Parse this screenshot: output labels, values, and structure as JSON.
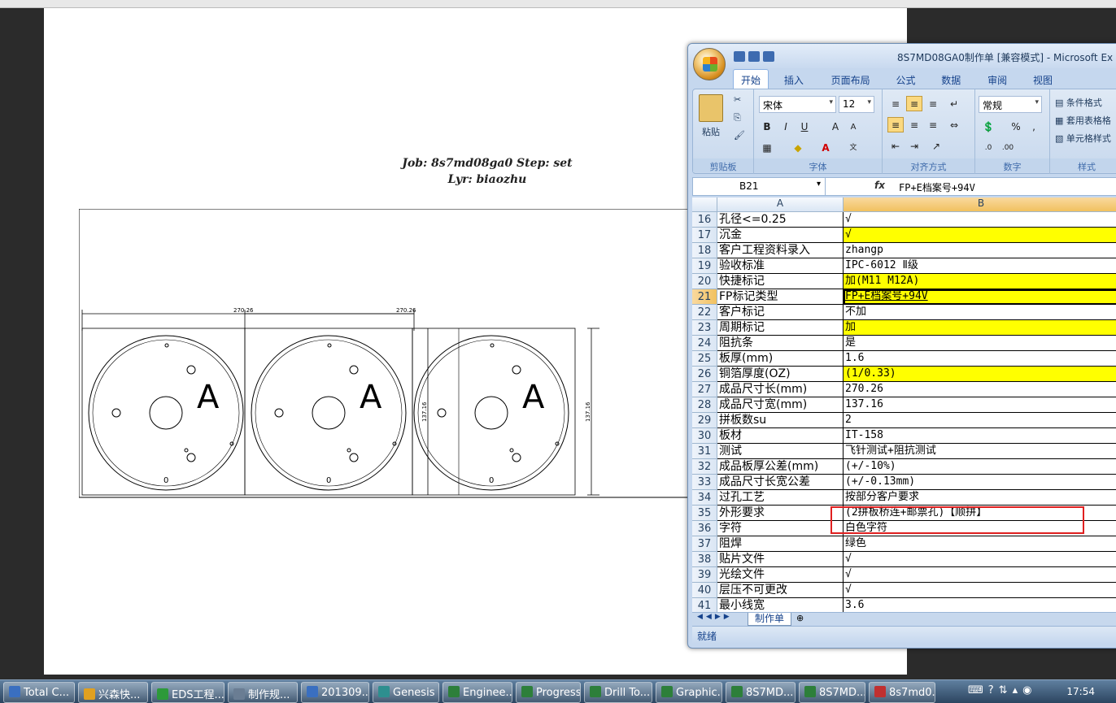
{
  "top_strip": "",
  "paper": {
    "job_line": "Job: 8s7md08ga0  Step: set",
    "lyr_line": "Lyr: biaozhu",
    "dim_top_1": "270.26",
    "dim_top_2": "270.26",
    "dim_side_1": "137.16",
    "dim_side_2": "137.16",
    "board_marks": [
      "A",
      "A",
      "A"
    ],
    "bottom_marks": [
      "0",
      "0",
      "0"
    ]
  },
  "excel": {
    "title": "8S7MD08GA0制作单  [兼容模式] - Microsoft Ex",
    "tabs": [
      "开始",
      "插入",
      "页面布局",
      "公式",
      "数据",
      "审阅",
      "视图"
    ],
    "clipboard": {
      "paste": "粘贴",
      "label": "剪贴板"
    },
    "font": {
      "name": "宋体",
      "size": "12",
      "label": "字体"
    },
    "align": {
      "label": "对齐方式"
    },
    "number": {
      "format": "常规",
      "label": "数字"
    },
    "styles": {
      "items": [
        "条件格式",
        "套用表格格",
        "单元格样式"
      ],
      "label": "样式"
    },
    "name_box": "B21",
    "fx": "fx",
    "formula": "FP+E档案号+94V",
    "col_a": "A",
    "col_b": "B",
    "rows": [
      {
        "n": "16",
        "a": "孔径<=0.25",
        "b": "√",
        "yellow": false
      },
      {
        "n": "17",
        "a": "沉金",
        "b": "√",
        "yellow": true
      },
      {
        "n": "18",
        "a": "客户工程资料录入",
        "b": "zhangp",
        "yellow": false
      },
      {
        "n": "19",
        "a": "验收标准",
        "b": "IPC-6012 Ⅱ级",
        "yellow": false
      },
      {
        "n": "20",
        "a": "快捷标记",
        "b": "加(M11 M12A)",
        "yellow": true
      },
      {
        "n": "21",
        "a": "FP标记类型",
        "b": "FP+E档案号+94V",
        "yellow": true,
        "active": true
      },
      {
        "n": "22",
        "a": "客户标记",
        "b": "不加",
        "yellow": false
      },
      {
        "n": "23",
        "a": "周期标记",
        "b": "加",
        "yellow": true
      },
      {
        "n": "24",
        "a": "阻抗条",
        "b": "是",
        "yellow": false
      },
      {
        "n": "25",
        "a": "板厚(mm)",
        "b": "1.6",
        "yellow": false
      },
      {
        "n": "26",
        "a": "铜箔厚度(OZ)",
        "b": "(1/0.33)",
        "yellow": true
      },
      {
        "n": "27",
        "a": "成品尺寸长(mm)",
        "b": "270.26",
        "yellow": false
      },
      {
        "n": "28",
        "a": "成品尺寸宽(mm)",
        "b": "137.16",
        "yellow": false
      },
      {
        "n": "29",
        "a": "拼板数su",
        "b": "2",
        "yellow": false
      },
      {
        "n": "30",
        "a": "板材",
        "b": "IT-158",
        "yellow": false
      },
      {
        "n": "31",
        "a": "测试",
        "b": "飞针测试+阻抗测试",
        "yellow": false
      },
      {
        "n": "32",
        "a": "成品板厚公差(mm)",
        "b": "(+/-10%)",
        "yellow": false
      },
      {
        "n": "33",
        "a": "成品尺寸长宽公差",
        "b": "(+/-0.13mm)",
        "yellow": false
      },
      {
        "n": "34",
        "a": "过孔工艺",
        "b": "按部分客户要求",
        "yellow": false
      },
      {
        "n": "35",
        "a": "外形要求",
        "b": "(2拼板桥连+邮票孔)【顺拼】",
        "yellow": false
      },
      {
        "n": "36",
        "a": "字符",
        "b": "白色字符",
        "yellow": false
      },
      {
        "n": "37",
        "a": "阻焊",
        "b": "绿色",
        "yellow": false
      },
      {
        "n": "38",
        "a": "贴片文件",
        "b": "√",
        "yellow": false
      },
      {
        "n": "39",
        "a": "光绘文件",
        "b": "√",
        "yellow": false
      },
      {
        "n": "40",
        "a": "层压不可更改",
        "b": "√",
        "yellow": false
      },
      {
        "n": "41",
        "a": "最小线宽",
        "b": "3.6",
        "yellow": false
      }
    ],
    "sheet_tab": "制作单",
    "status": "就绪"
  },
  "taskbar": {
    "items": [
      "Total C...",
      "兴森快...",
      "EDS工程...",
      "制作规...",
      "201309...",
      "Genesis",
      "Enginee...",
      "Progress",
      "Drill To...",
      "Graphic...",
      "8S7MD...",
      "8S7MD...",
      "8s7md0..."
    ],
    "icon_colors": [
      "#3a6fc0",
      "#e0a020",
      "#2d9a3a",
      "#6a7d93",
      "#3a6fc0",
      "#2e8f8f",
      "#2d7f3a",
      "#2d7f3a",
      "#2d7f3a",
      "#2d7f3a",
      "#2d7f3a",
      "#2d7f3a",
      "#c03030"
    ],
    "clock": "17:54"
  }
}
